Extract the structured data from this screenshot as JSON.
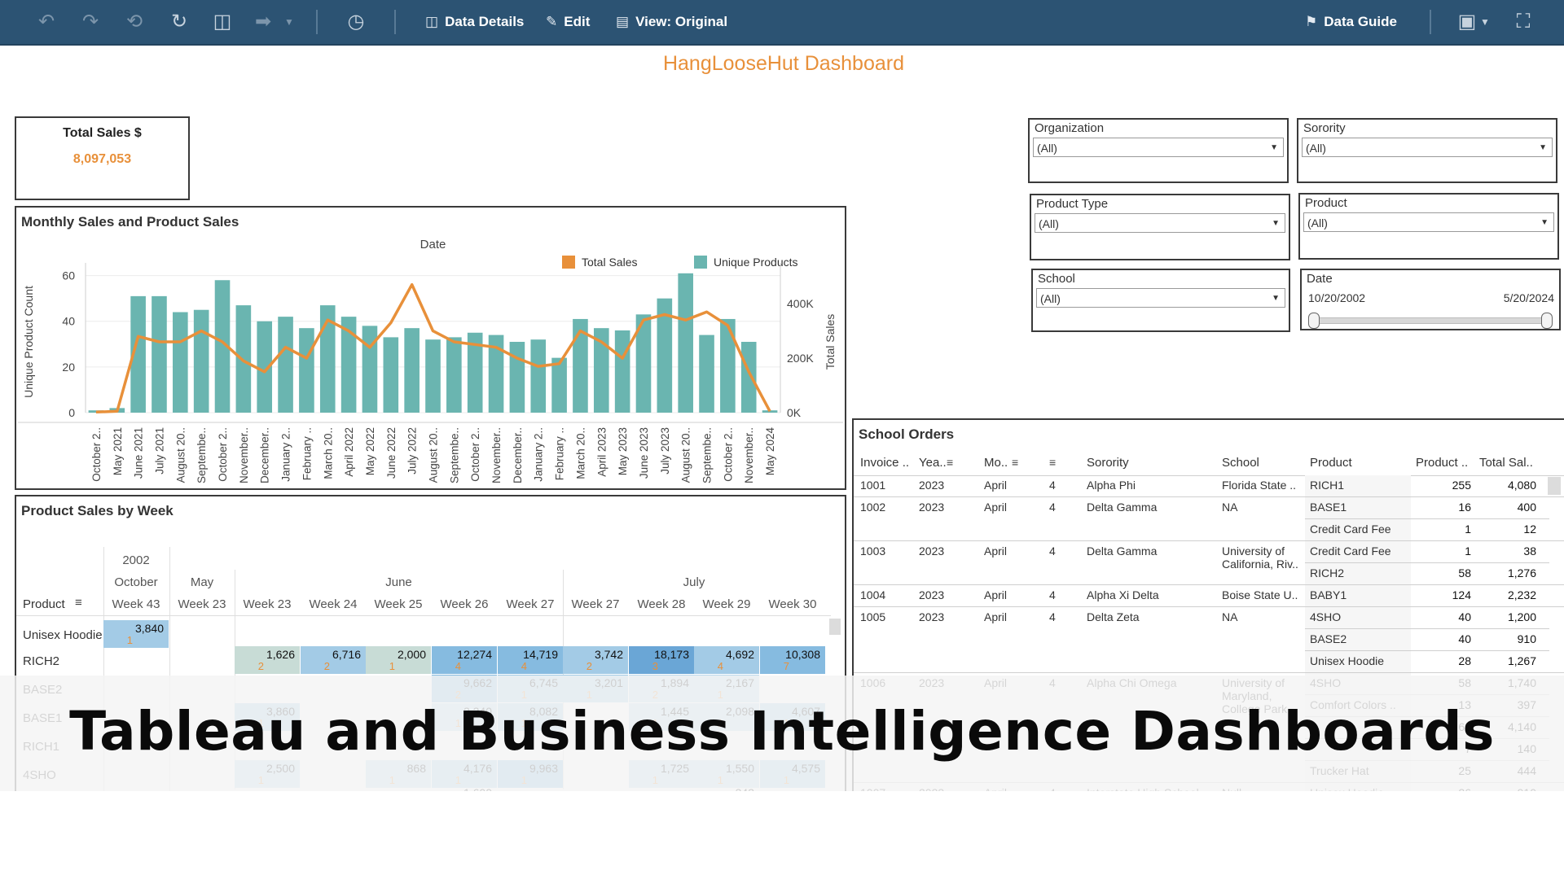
{
  "toolbar": {
    "data_details": "Data Details",
    "edit": "Edit",
    "view": "View: Original",
    "data_guide": "Data Guide"
  },
  "dashboard_title": "HangLooseHut Dashboard",
  "kpi": {
    "label": "Total Sales $",
    "value": "8,097,053"
  },
  "filters": {
    "organization": {
      "label": "Organization",
      "value": "(All)"
    },
    "sorority": {
      "label": "Sorority",
      "value": "(All)"
    },
    "product_type": {
      "label": "Product Type",
      "value": "(All)"
    },
    "product": {
      "label": "Product",
      "value": "(All)"
    },
    "school": {
      "label": "School",
      "value": "(All)"
    },
    "date": {
      "label": "Date",
      "start": "10/20/2002",
      "end": "5/20/2024"
    }
  },
  "monthly": {
    "title": "Monthly Sales and Product Sales",
    "chart_data": {
      "type": "bar",
      "title": "Monthly Sales and Product Sales",
      "xlabel": "Date",
      "ylabel": "Unique Product Count",
      "y2label": "Total Sales",
      "ylim": [
        0,
        62
      ],
      "y2lim": [
        0,
        520000
      ],
      "yticks": [
        "0",
        "20",
        "40",
        "60"
      ],
      "y2ticks": [
        "0K",
        "200K",
        "400K"
      ],
      "legend": [
        "Total Sales",
        "Unique Products"
      ],
      "legend_position": "top-right",
      "colors": {
        "bars": "#6ab5b0",
        "line": "#e8903a"
      },
      "categories": [
        "October 2..",
        "May 2021",
        "June 2021",
        "July 2021",
        "August 20..",
        "Septembe..",
        "October 2..",
        "November..",
        "December..",
        "January 2..",
        "February ..",
        "March 20..",
        "April 2022",
        "May 2022",
        "June 2022",
        "July 2022",
        "August 20..",
        "Septembe..",
        "October 2..",
        "November..",
        "December..",
        "January 2..",
        "February ..",
        "March 20..",
        "April 2023",
        "May 2023",
        "June 2023",
        "July 2023",
        "August 20..",
        "Septembe..",
        "October 2..",
        "November..",
        "May 2024"
      ],
      "series": [
        {
          "name": "Unique Products",
          "values": [
            1,
            2,
            51,
            51,
            44,
            45,
            58,
            47,
            40,
            42,
            37,
            47,
            42,
            38,
            33,
            37,
            32,
            33,
            35,
            34,
            31,
            32,
            24,
            41,
            37,
            36,
            43,
            50,
            61,
            34,
            41,
            31,
            1
          ]
        },
        {
          "name": "Total Sales",
          "values": [
            2000,
            5000,
            280000,
            260000,
            260000,
            300000,
            260000,
            190000,
            150000,
            240000,
            200000,
            340000,
            300000,
            240000,
            330000,
            470000,
            300000,
            260000,
            250000,
            240000,
            200000,
            170000,
            180000,
            300000,
            260000,
            200000,
            340000,
            360000,
            340000,
            370000,
            320000,
            150000,
            5000
          ]
        }
      ]
    }
  },
  "weekly": {
    "title": "Product Sales by Week",
    "year": "2002",
    "months": [
      "October",
      "May",
      "June",
      "July"
    ],
    "product_header": "Product",
    "weeks": [
      "Week 43",
      "Week 23",
      "Week 23",
      "Week 24",
      "Week 25",
      "Week 26",
      "Week 27",
      "Week 27",
      "Week 28",
      "Week 29",
      "Week 30"
    ],
    "rows": [
      {
        "label": "Unisex Hoodie",
        "cells": [
          [
            "3,840",
            "1"
          ],
          null,
          null,
          null,
          null,
          null,
          null,
          null,
          null,
          null,
          null
        ]
      },
      {
        "label": "RICH2",
        "cells": [
          null,
          null,
          [
            "1,626",
            "2"
          ],
          [
            "6,716",
            "2"
          ],
          [
            "2,000",
            "1"
          ],
          [
            "12,274",
            "4"
          ],
          [
            "14,719",
            "4"
          ],
          [
            "3,742",
            "2"
          ],
          [
            "18,173",
            "3"
          ],
          [
            "4,692",
            "4"
          ],
          [
            "10,308",
            "7"
          ]
        ]
      },
      {
        "label": "BASE2",
        "cells": [
          null,
          null,
          null,
          null,
          null,
          [
            "9,662",
            "2"
          ],
          [
            "6,745",
            "1"
          ],
          [
            "3,201",
            "1"
          ],
          [
            "1,894",
            "2"
          ],
          [
            "2,167",
            "1"
          ],
          null
        ]
      },
      {
        "label": "BASE1",
        "cells": [
          null,
          null,
          [
            "3,860",
            "1"
          ],
          null,
          null,
          [
            "2,240",
            "1"
          ],
          [
            "8,082",
            "1"
          ],
          null,
          [
            "1,445",
            "1"
          ],
          [
            "2,098",
            "1"
          ],
          [
            "4,607",
            "1"
          ]
        ]
      },
      {
        "label": "RICH1",
        "cells": [
          null,
          null,
          null,
          null,
          null,
          null,
          null,
          null,
          null,
          null,
          null
        ]
      },
      {
        "label": "4SHO",
        "cells": [
          null,
          null,
          [
            "2,500",
            "1"
          ],
          null,
          [
            "868",
            "1"
          ],
          [
            "4,176",
            "1"
          ],
          [
            "9,963",
            "1"
          ],
          null,
          [
            "1,725",
            "1"
          ],
          [
            "1,550",
            "1"
          ],
          [
            "4,575",
            "1"
          ]
        ]
      }
    ],
    "extra_visible": "1,600",
    "extra_visible_2": "343"
  },
  "school_orders": {
    "title": "School Orders",
    "headers": [
      "Invoice ..",
      "Yea..",
      "Mo..",
      "",
      "Sorority",
      "School",
      "Product",
      "Product ..",
      "Total Sal.."
    ],
    "rows": [
      {
        "invoice": "1001",
        "year": "2023",
        "month": "April",
        "num": "4",
        "sorority": "Alpha Phi",
        "school": "Florida State ..",
        "items": [
          [
            "RICH1",
            "255",
            "4,080"
          ]
        ]
      },
      {
        "invoice": "1002",
        "year": "2023",
        "month": "April",
        "num": "4",
        "sorority": "Delta Gamma",
        "school": "NA",
        "items": [
          [
            "BASE1",
            "16",
            "400"
          ],
          [
            "Credit Card Fee",
            "1",
            "12"
          ]
        ]
      },
      {
        "invoice": "1003",
        "year": "2023",
        "month": "April",
        "num": "4",
        "sorority": "Delta Gamma",
        "school": "University of California, Riv..",
        "items": [
          [
            "Credit Card Fee",
            "1",
            "38"
          ],
          [
            "RICH2",
            "58",
            "1,276"
          ]
        ]
      },
      {
        "invoice": "1004",
        "year": "2023",
        "month": "April",
        "num": "4",
        "sorority": "Alpha Xi Delta",
        "school": "Boise State U..",
        "items": [
          [
            "BABY1",
            "124",
            "2,232"
          ]
        ]
      },
      {
        "invoice": "1005",
        "year": "2023",
        "month": "April",
        "num": "4",
        "sorority": "Delta Zeta",
        "school": "NA",
        "items": [
          [
            "4SHO",
            "40",
            "1,200"
          ],
          [
            "BASE2",
            "40",
            "910"
          ],
          [
            "Unisex Hoodie",
            "28",
            "1,267"
          ]
        ]
      },
      {
        "invoice": "1006",
        "year": "2023",
        "month": "April",
        "num": "4",
        "sorority": "Alpha Chi Omega",
        "school": "University of Maryland, College Park",
        "items": [
          [
            "4SHO",
            "58",
            "1,740"
          ],
          [
            "Comfort Colors ..",
            "13",
            "397"
          ],
          [
            "",
            "69",
            "4,140"
          ],
          [
            "",
            "7",
            "140"
          ],
          [
            "Trucker Hat",
            "25",
            "444"
          ]
        ]
      },
      {
        "invoice": "1007",
        "year": "2023",
        "month": "April",
        "num": "4",
        "sorority": "Interstate High School",
        "school": "Null",
        "items": [
          [
            "Unisex Hoodie",
            "26",
            "910"
          ]
        ]
      }
    ]
  },
  "banner_text": "Tableau and Business Intelligence Dashboards"
}
